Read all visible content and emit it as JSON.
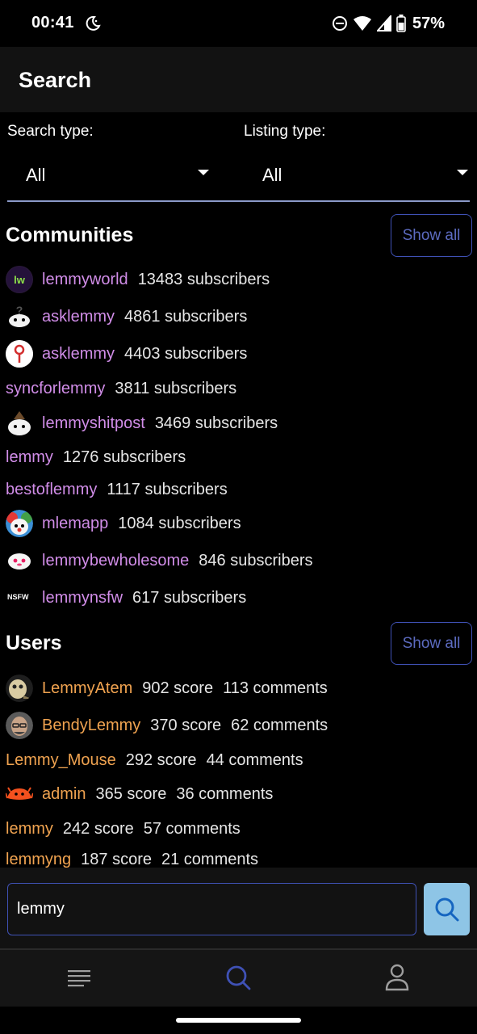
{
  "status": {
    "time": "00:41",
    "battery": "57%"
  },
  "app_bar": {
    "title": "Search"
  },
  "filters": {
    "search_type_label": "Search type:",
    "search_type_value": "All",
    "listing_type_label": "Listing type:",
    "listing_type_value": "All"
  },
  "communities": {
    "title": "Communities",
    "show_all": "Show all",
    "items": [
      {
        "name": "lemmyworld",
        "meta": "13483 subscribers",
        "icon": "lemmyworld-avatar"
      },
      {
        "name": "asklemmy",
        "meta": "4861 subscribers",
        "icon": "question-lemming-avatar"
      },
      {
        "name": "asklemmy",
        "meta": "4403 subscribers",
        "icon": "red-question-avatar"
      },
      {
        "name": "syncforlemmy",
        "meta": "3811 subscribers",
        "icon": ""
      },
      {
        "name": "lemmyshitpost",
        "meta": "3469 subscribers",
        "icon": "lemming-hat-avatar"
      },
      {
        "name": "lemmy",
        "meta": "1276 subscribers",
        "icon": ""
      },
      {
        "name": "bestoflemmy",
        "meta": "1117 subscribers",
        "icon": ""
      },
      {
        "name": "mlemapp",
        "meta": "1084 subscribers",
        "icon": "clown-avatar"
      },
      {
        "name": "lemmybewholesome",
        "meta": "846 subscribers",
        "icon": "pink-lemming-avatar"
      },
      {
        "name": "lemmynsfw",
        "meta": "617 subscribers",
        "icon": "nsfw-avatar"
      }
    ],
    "nsfw_badge": "NSFW"
  },
  "users": {
    "title": "Users",
    "show_all": "Show all",
    "items": [
      {
        "name": "LemmyAtem",
        "score": "902 score",
        "comments": "113 comments",
        "icon": "user-avatar"
      },
      {
        "name": "BendyLemmy",
        "score": "370 score",
        "comments": "62 comments",
        "icon": "portrait-avatar"
      },
      {
        "name": "Lemmy_Mouse",
        "score": "292 score",
        "comments": "44 comments",
        "icon": ""
      },
      {
        "name": "admin",
        "score": "365 score",
        "comments": "36 comments",
        "icon": "crab-avatar"
      },
      {
        "name": "lemmy",
        "score": "242 score",
        "comments": "57 comments",
        "icon": ""
      },
      {
        "name": "lemmyng",
        "score": "187 score",
        "comments": "21 comments",
        "icon": ""
      }
    ]
  },
  "search": {
    "value": "lemmy"
  },
  "colors": {
    "accent": "#3f51b5",
    "community_name": "#d18de8",
    "user_name": "#f0a350",
    "search_button": "#8ec5e6"
  },
  "nav": {
    "items": [
      "feed-icon",
      "search-icon",
      "profile-icon"
    ],
    "active": "search-icon"
  }
}
